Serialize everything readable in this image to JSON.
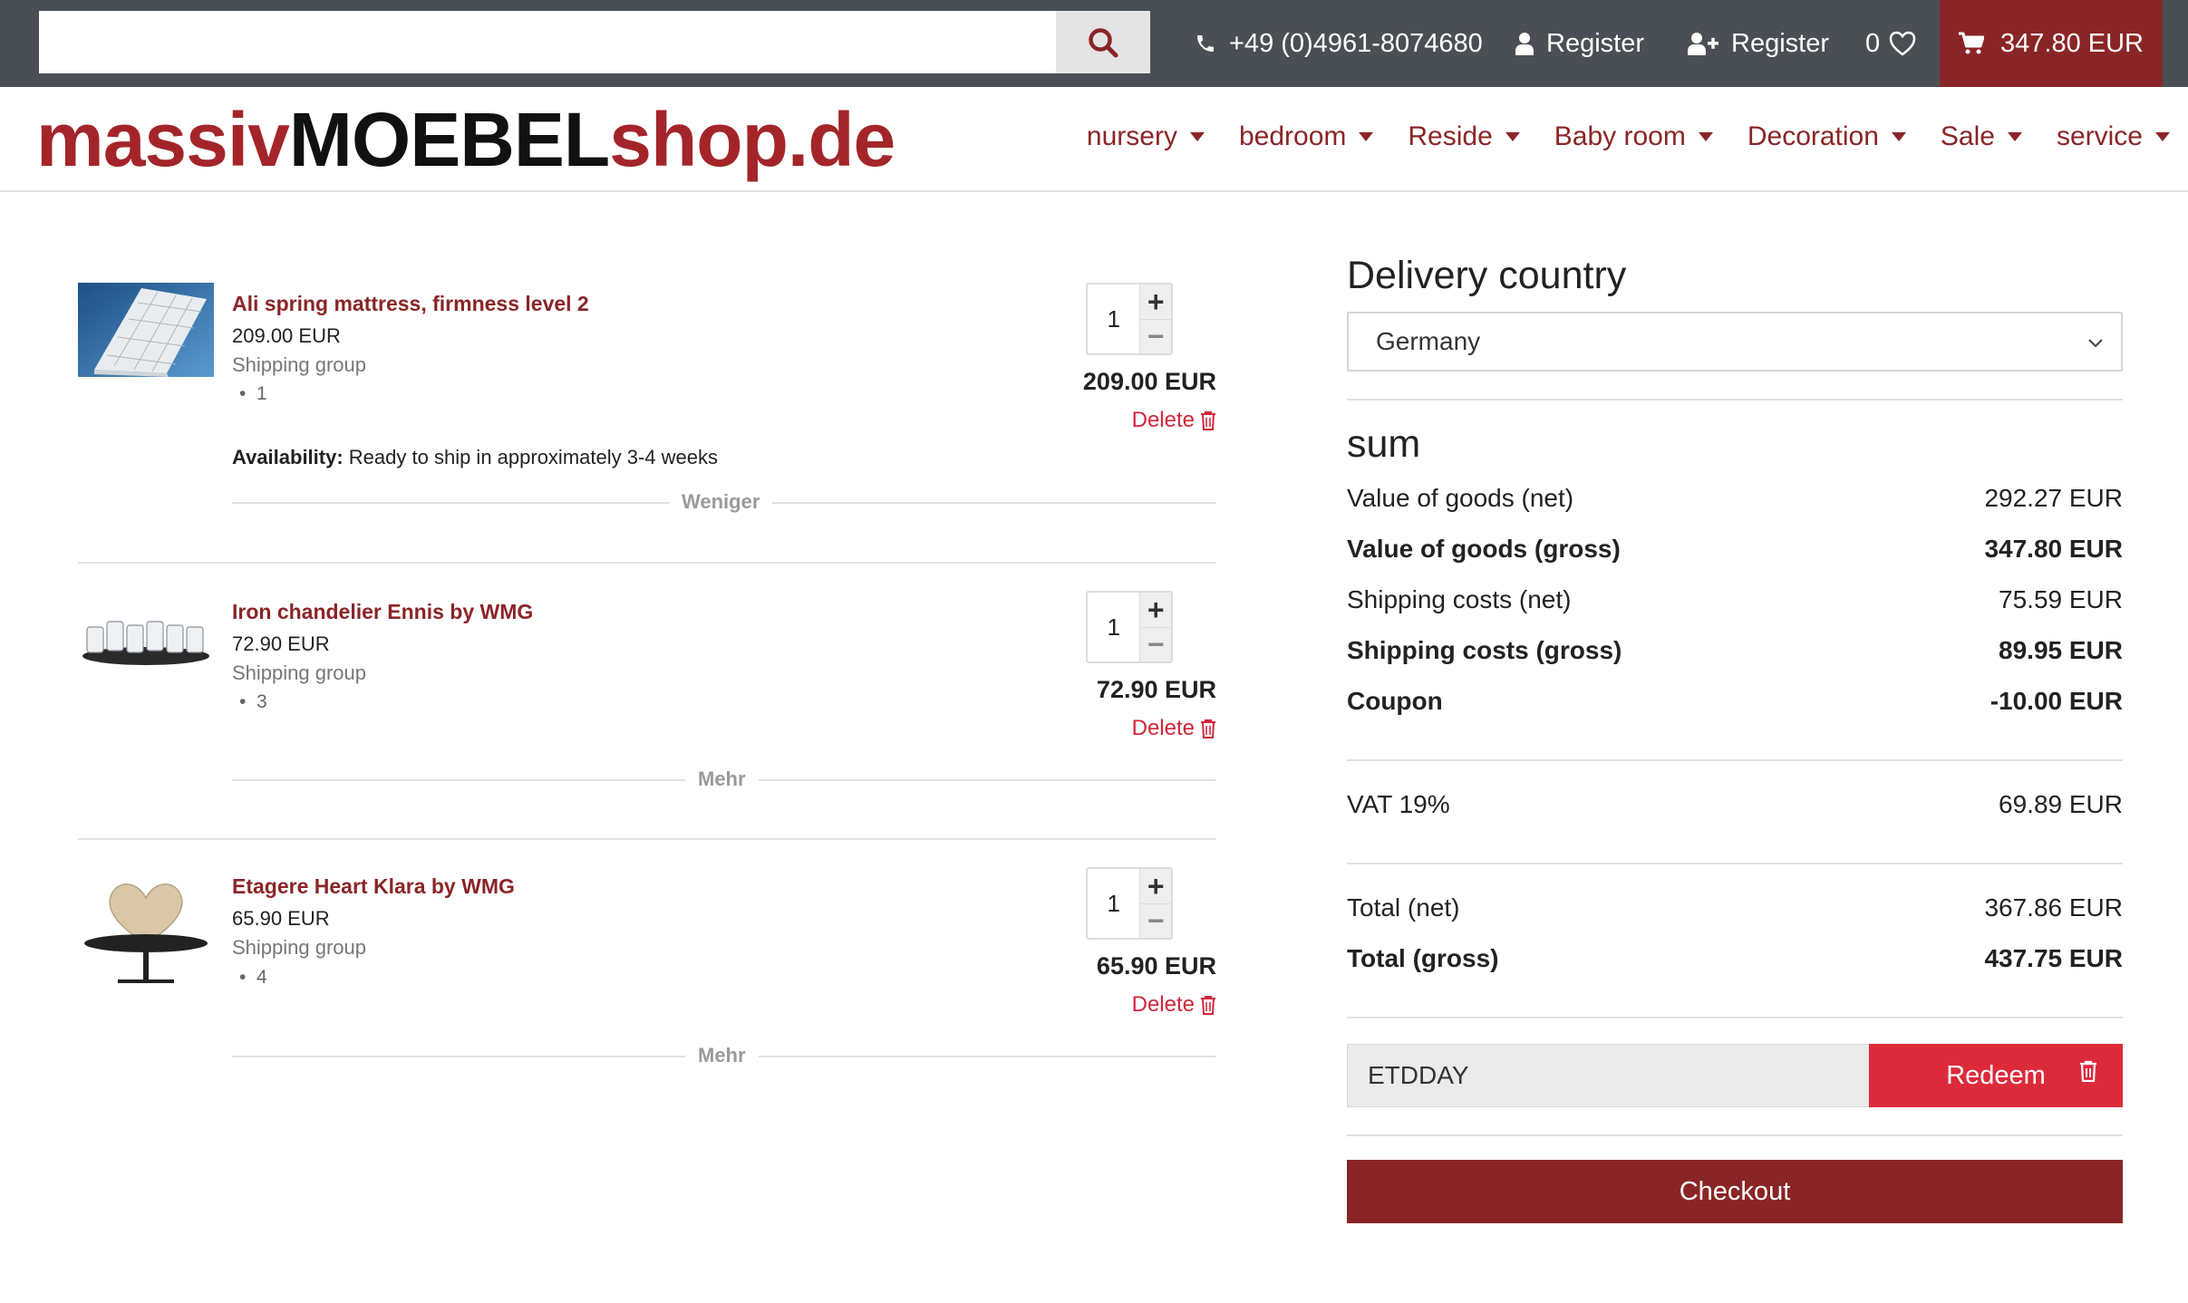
{
  "search": {
    "placeholder": ""
  },
  "topbar": {
    "phone": "+49 (0)4961-8074680",
    "register_1": "Register",
    "register_2": "Register",
    "wishlist_count": "0",
    "cart_total": "347.80 EUR"
  },
  "logo": {
    "part1": "massiv",
    "part2": "MOEBEL",
    "part3": "shop.de"
  },
  "nav": [
    {
      "label": "nursery"
    },
    {
      "label": "bedroom"
    },
    {
      "label": "Reside"
    },
    {
      "label": "Baby room"
    },
    {
      "label": "Decoration"
    },
    {
      "label": "Sale"
    },
    {
      "label": "service"
    }
  ],
  "cart": {
    "items": [
      {
        "title": "Ali spring mattress, firmness level 2",
        "price": "209.00 EUR",
        "shipping_label": "Shipping group",
        "shipping_group": "1",
        "availability_label": "Availability:",
        "availability_value": "Ready to ship in approximately 3-4 weeks",
        "qty": "1",
        "line_total": "209.00 EUR",
        "delete_label": "Delete",
        "toggle_label": "Weniger"
      },
      {
        "title": "Iron chandelier Ennis by WMG",
        "price": "72.90 EUR",
        "shipping_label": "Shipping group",
        "shipping_group": "3",
        "qty": "1",
        "line_total": "72.90 EUR",
        "delete_label": "Delete",
        "toggle_label": "Mehr"
      },
      {
        "title": "Etagere Heart Klara by WMG",
        "price": "65.90 EUR",
        "shipping_label": "Shipping group",
        "shipping_group": "4",
        "qty": "1",
        "line_total": "65.90 EUR",
        "delete_label": "Delete",
        "toggle_label": "Mehr"
      }
    ]
  },
  "summary": {
    "delivery_heading": "Delivery country",
    "country": "Germany",
    "sum_heading": "sum",
    "rows": [
      {
        "label": "Value of goods (net)",
        "value": "292.27 EUR"
      },
      {
        "label": "Value of goods (gross)",
        "value": "347.80 EUR"
      },
      {
        "label": "Shipping costs (net)",
        "value": "75.59 EUR"
      },
      {
        "label": "Shipping costs (gross)",
        "value": "89.95 EUR"
      },
      {
        "label": "Coupon",
        "value": "-10.00 EUR"
      },
      {
        "label": "VAT 19%",
        "value": "69.89 EUR"
      },
      {
        "label": "Total (net)",
        "value": "367.86 EUR"
      },
      {
        "label": "Total (gross)",
        "value": "437.75 EUR"
      }
    ],
    "coupon_code": "ETDDAY",
    "redeem_label": "Redeem",
    "checkout_label": "Checkout"
  },
  "colors": {
    "topbar_bg": "#4a4f55",
    "brand_red": "#8a2527",
    "redeem_red": "#dd2a3b",
    "delete_red": "#d0273a"
  }
}
